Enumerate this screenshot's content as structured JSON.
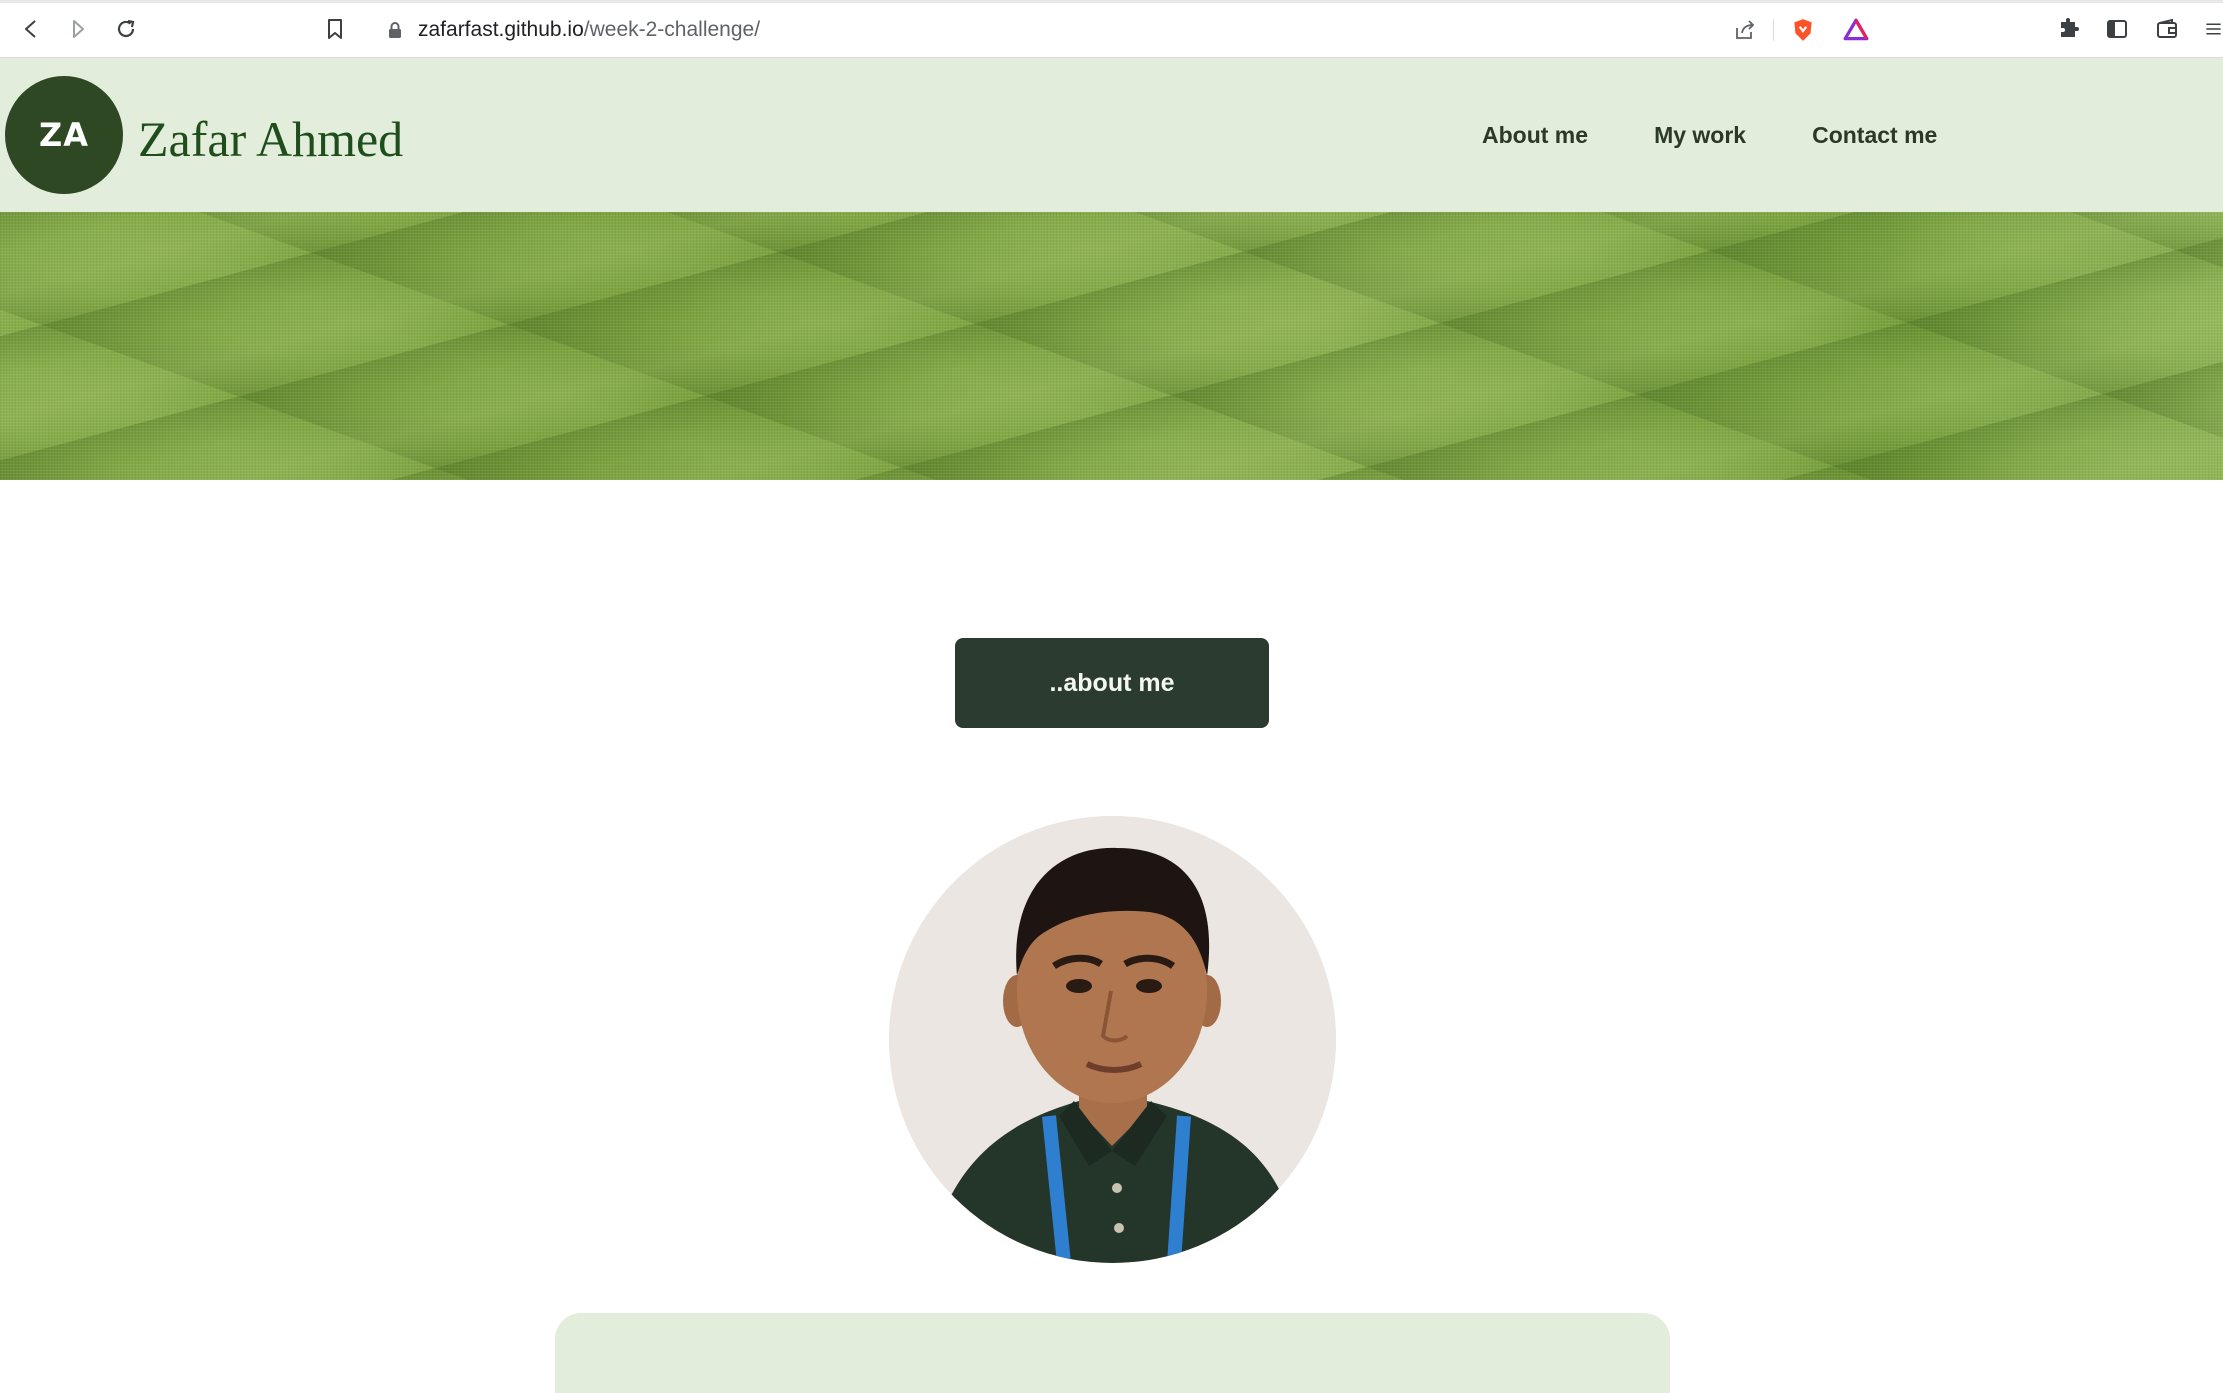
{
  "browser": {
    "url_host": "zafarfast.github.io",
    "url_path": "/week-2-challenge/",
    "icons": [
      "back-icon",
      "forward-icon",
      "reload-icon",
      "bookmark-icon",
      "lock-icon",
      "share-icon",
      "brave-shields-icon",
      "brave-rewards-icon",
      "extensions-icon",
      "sidebar-icon",
      "wallet-icon",
      "menu-icon"
    ]
  },
  "header": {
    "logo_text": "ZA",
    "site_name": "Zafar Ahmed",
    "nav": [
      "About me",
      "My work",
      "Contact me"
    ]
  },
  "main": {
    "section_button": "..about me",
    "portrait_alt": "Portrait of Zafar Ahmed"
  },
  "colors": {
    "header_bg": "#e2eedb",
    "brand_dark_green": "#2e4823",
    "button_bg": "#2b3b2f",
    "hero_green": "#7ea442"
  }
}
